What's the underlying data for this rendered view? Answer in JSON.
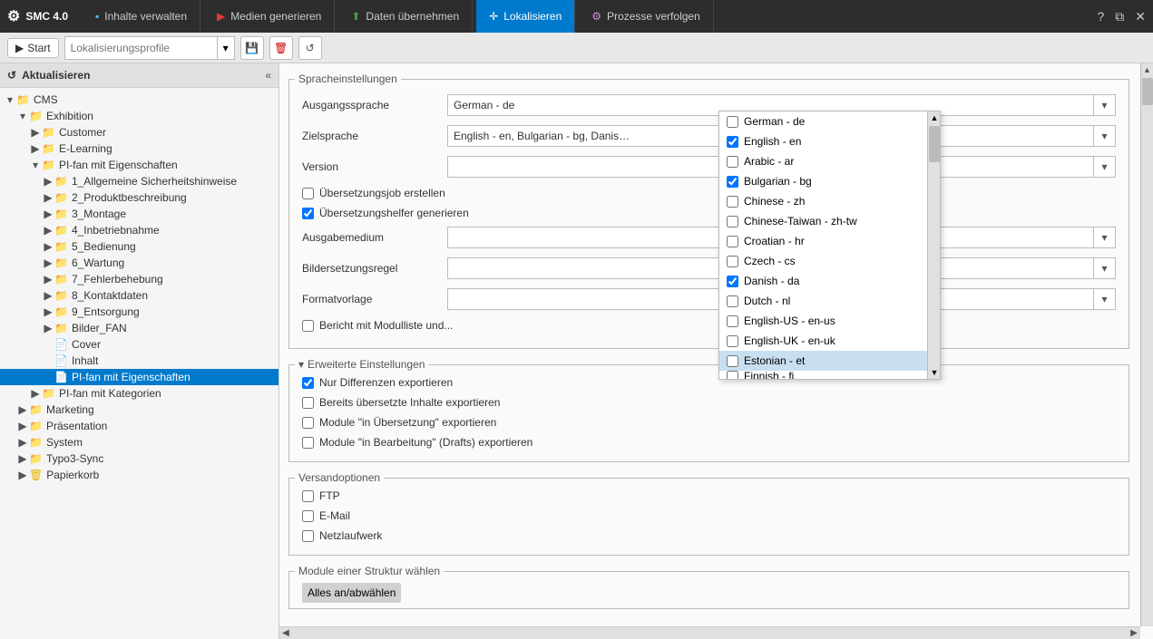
{
  "titlebar": {
    "app_name": "SMC 4.0",
    "tabs": [
      {
        "label": "Inhalte verwalten",
        "icon": "content",
        "active": false
      },
      {
        "label": "Medien generieren",
        "icon": "media",
        "active": false
      },
      {
        "label": "Daten übernehmen",
        "icon": "data",
        "active": false
      },
      {
        "label": "Lokalisieren",
        "icon": "localize",
        "active": true
      },
      {
        "label": "Prozesse verfolgen",
        "icon": "process",
        "active": false
      }
    ],
    "actions": [
      "help",
      "restore",
      "close"
    ]
  },
  "toolbar": {
    "start_label": "Start",
    "profile_placeholder": "Lokalisierungsprofile",
    "save_icon": "💾",
    "delete_icon": "🗑",
    "refresh_icon": "↺"
  },
  "sidebar": {
    "refresh_label": "Aktualisieren",
    "tree": {
      "root": "CMS",
      "items": [
        {
          "id": "cms",
          "label": "CMS",
          "level": 0,
          "type": "folder",
          "expanded": true
        },
        {
          "id": "exhibition",
          "label": "Exhibition",
          "level": 1,
          "type": "folder",
          "expanded": true
        },
        {
          "id": "customer",
          "label": "Customer",
          "level": 2,
          "type": "folder",
          "expanded": false
        },
        {
          "id": "elearning",
          "label": "E-Learning",
          "level": 2,
          "type": "folder",
          "expanded": false
        },
        {
          "id": "pifan",
          "label": "PI-fan mit Eigenschaften",
          "level": 2,
          "type": "folder",
          "expanded": true
        },
        {
          "id": "allgemein",
          "label": "1_Allgemeine Sicherheitshinweise",
          "level": 3,
          "type": "folder",
          "expanded": false
        },
        {
          "id": "produkt",
          "label": "2_Produktbeschreibung",
          "level": 3,
          "type": "folder",
          "expanded": false
        },
        {
          "id": "montage",
          "label": "3_Montage",
          "level": 3,
          "type": "folder",
          "expanded": false
        },
        {
          "id": "inbetriebnahme",
          "label": "4_Inbetriebnahme",
          "level": 3,
          "type": "folder",
          "expanded": false
        },
        {
          "id": "bedienung",
          "label": "5_Bedienung",
          "level": 3,
          "type": "folder",
          "expanded": false
        },
        {
          "id": "wartung",
          "label": "6_Wartung",
          "level": 3,
          "type": "folder",
          "expanded": false
        },
        {
          "id": "fehlerbehebung",
          "label": "7_Fehlerbehebung",
          "level": 3,
          "type": "folder",
          "expanded": false
        },
        {
          "id": "kontaktdaten",
          "label": "8_Kontaktdaten",
          "level": 3,
          "type": "folder",
          "expanded": false
        },
        {
          "id": "entsorgung",
          "label": "9_Entsorgung",
          "level": 3,
          "type": "folder",
          "expanded": false
        },
        {
          "id": "bilder",
          "label": "Bilder_FAN",
          "level": 3,
          "type": "folder",
          "expanded": false
        },
        {
          "id": "cover",
          "label": "Cover",
          "level": 3,
          "type": "file",
          "expanded": false
        },
        {
          "id": "inhalt",
          "label": "Inhalt",
          "level": 3,
          "type": "file",
          "expanded": false
        },
        {
          "id": "pifan_selected",
          "label": "PI-fan mit Eigenschaften",
          "level": 3,
          "type": "file",
          "expanded": false,
          "selected": true
        },
        {
          "id": "pifan_kategorien",
          "label": "PI-fan mit Kategorien",
          "level": 2,
          "type": "folder",
          "expanded": false
        },
        {
          "id": "marketing",
          "label": "Marketing",
          "level": 1,
          "type": "folder",
          "expanded": false
        },
        {
          "id": "praesentation",
          "label": "Präsentation",
          "level": 1,
          "type": "folder",
          "expanded": false
        },
        {
          "id": "system",
          "label": "System",
          "level": 1,
          "type": "folder",
          "expanded": false
        },
        {
          "id": "typo3sync",
          "label": "Typo3-Sync",
          "level": 1,
          "type": "folder",
          "expanded": false
        },
        {
          "id": "papierkorb",
          "label": "Papierkorb",
          "level": 1,
          "type": "folder",
          "expanded": false
        }
      ]
    }
  },
  "content": {
    "spracheinstellungen": {
      "title": "Spracheinstellungen",
      "ausgangssprache_label": "Ausgangssprache",
      "ausgangssprache_value": "German - de",
      "zielsprache_label": "Zielsprache",
      "zielsprache_value": "English - en, Bulgarian - bg, Danish - d...",
      "version_label": "Version",
      "uebersetzungsjob_label": "Übersetzungsjob erstellen",
      "uebersetzungshelfer_label": "Übersetzungshelfer generieren",
      "ausgabemedium_label": "Ausgabemedium",
      "bildersetzungsregel_label": "Bildersetzungsregel",
      "formatvorlage_label": "Formatvorlage",
      "bericht_label": "Bericht mit Modulliste und..."
    },
    "erweiterte": {
      "title": "Erweiterte Einstellungen",
      "nur_differenzen_label": "Nur Differenzen exportieren",
      "bereits_uebersetzt_label": "Bereits übersetzte Inhalte exportieren",
      "module_uebersetzung_label": "Module \"in Übersetzung\" exportieren",
      "module_bearbeitung_label": "Module \"in Bearbeitung\" (Drafts) exportieren"
    },
    "versandoptionen": {
      "title": "Versandoptionen",
      "ftp_label": "FTP",
      "email_label": "E-Mail",
      "netzlaufwerk_label": "Netzlaufwerk"
    },
    "module_struktur": {
      "title": "Module einer Struktur wählen",
      "alles_label": "Alles an/abwählen"
    }
  },
  "dropdown": {
    "items": [
      {
        "label": "German - de",
        "checked": false
      },
      {
        "label": "English - en",
        "checked": true
      },
      {
        "label": "Arabic - ar",
        "checked": false
      },
      {
        "label": "Bulgarian - bg",
        "checked": true
      },
      {
        "label": "Chinese - zh",
        "checked": false
      },
      {
        "label": "Chinese-Taiwan - zh-tw",
        "checked": false
      },
      {
        "label": "Croatian - hr",
        "checked": false
      },
      {
        "label": "Czech - cs",
        "checked": false
      },
      {
        "label": "Danish - da",
        "checked": true
      },
      {
        "label": "Dutch - nl",
        "checked": false
      },
      {
        "label": "English-US - en-us",
        "checked": false
      },
      {
        "label": "English-UK - en-uk",
        "checked": false
      },
      {
        "label": "Estonian - et",
        "checked": false,
        "highlighted": true
      },
      {
        "label": "Finnish - fi",
        "checked": false
      }
    ]
  }
}
